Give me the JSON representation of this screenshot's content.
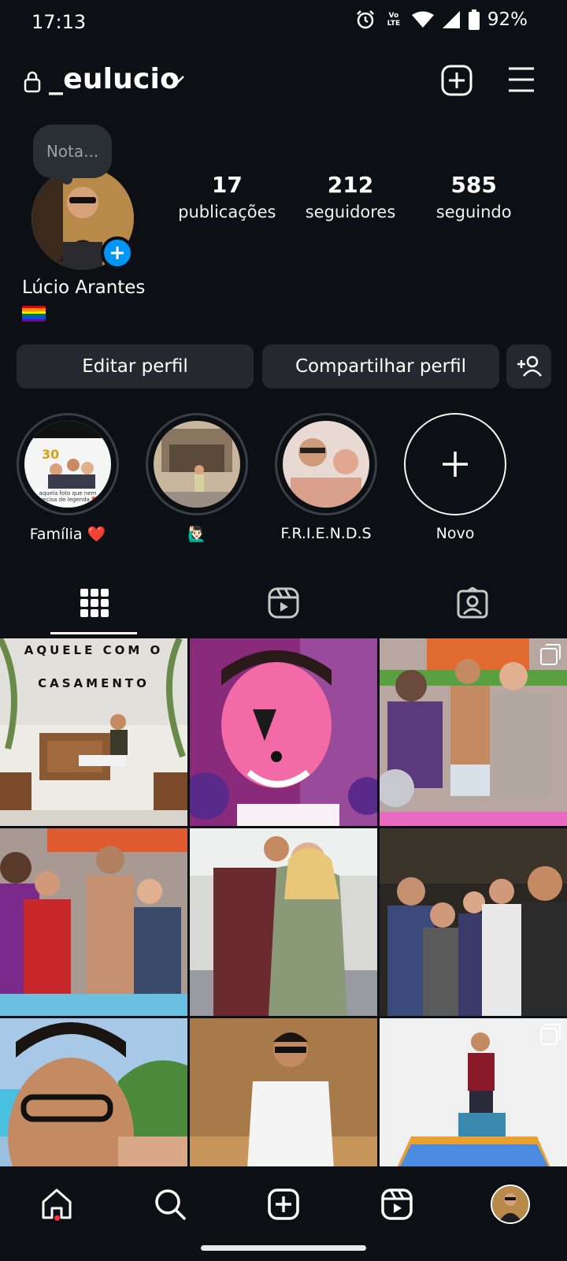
{
  "status_bar": {
    "time": "17:13",
    "volte": "Vo)) LTE",
    "battery": "92%",
    "icons": [
      "alarm-icon",
      "volte-icon",
      "wifi-icon",
      "signal-icon",
      "battery-icon"
    ]
  },
  "header": {
    "username": "_eulucio",
    "icons": [
      "lock-icon",
      "chevron-down-icon",
      "new-post-icon",
      "menu-icon"
    ]
  },
  "profile": {
    "note_placeholder": "Nota...",
    "full_name": "Lúcio Arantes",
    "bio_emoji": "🏳️‍🌈",
    "stats": [
      {
        "value": "17",
        "label": "publicações"
      },
      {
        "value": "212",
        "label": "seguidores"
      },
      {
        "value": "585",
        "label": "seguindo"
      }
    ]
  },
  "buttons": {
    "edit": "Editar perfil",
    "share": "Compartilhar perfil"
  },
  "highlights": [
    {
      "label": "Família ❤️"
    },
    {
      "label": "🙋🏻‍♂️"
    },
    {
      "label": "F.R.I.E.N.D.S"
    },
    {
      "label": "Novo"
    }
  ],
  "grid": {
    "first_caption": "AQUELE COM O CASAMENTO",
    "first_caption_line1": "AQUELE COM O",
    "first_caption_line2": "CASAMENTO"
  },
  "highlight_caption": "aquela foto que nem precisa de legenda ❤️",
  "colors": {
    "background": "#0c0f14",
    "button_bg": "#25292f",
    "accent_blue": "#0095f6",
    "notification_red": "#ff3040"
  },
  "bottom_nav": [
    "home-icon",
    "search-icon",
    "create-icon",
    "reels-icon",
    "profile-avatar"
  ]
}
